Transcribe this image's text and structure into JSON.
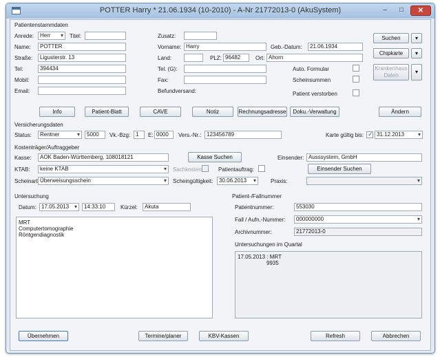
{
  "window": {
    "title": "POTTER Harry * 21.06.1934 (10-2010) - A-Nr 21772013-0 (AkuSystem)",
    "minimize": "‒",
    "maximize": "□",
    "close": "✕"
  },
  "patient": {
    "section": "Patientenstammdaten",
    "anrede_label": "Anrede:",
    "anrede": "Herr",
    "titel_label": "Titel:",
    "titel": "",
    "zusatz_label": "Zusatz:",
    "zusatz": "",
    "name_label": "Name:",
    "name": "POTTER",
    "vorname_label": "Vorname:",
    "vorname": "Harry",
    "gebdatum_label": "Geb.-Datum:",
    "gebdatum": "21.06.1934",
    "strasse_label": "Straße:",
    "strasse": "Ligusterstr. 13",
    "land_label": "Land:",
    "land": "",
    "plz_label": "PLZ:",
    "plz": "96482",
    "ort_label": "Ort:",
    "ort": "Ahorn",
    "tel_label": "Tel:",
    "tel": "394434",
    "telg_label": "Tel. (G):",
    "telg": "",
    "mobil_label": "Mobil:",
    "mobil": "",
    "fax_label": "Fax:",
    "fax": "",
    "email_label": "Email:",
    "email": "",
    "befund_label": "Befundversand:",
    "auto_formular": "Auto. Formular",
    "scheinsummen": "Scheinsummen",
    "verstorben": "Patient verstorben"
  },
  "side_buttons": {
    "suchen": "Suchen",
    "chipkarte": "Chipkarte",
    "krankenhaus": "Krankenhaus Daten"
  },
  "tabs_row": [
    "Info",
    "Patient-Blatt",
    "CAVE",
    "Notiz",
    "Rechnungsadresse",
    "Doku.-Verwaltung"
  ],
  "aendern": "Ändern",
  "insurance": {
    "section": "Versicherungsdaten",
    "status_label": "Status:",
    "status": "Rentner",
    "status_code": "5000",
    "vknr_label": "Vk.-Bzg:",
    "vknr": "1",
    "e_label": "E:",
    "e": "0000",
    "versnr_label": "Vers.-Nr.:",
    "versnr": "123456789",
    "karte_label": "Karte gültig bis:",
    "karte": "31.12.2013"
  },
  "kostentraeger": {
    "section": "Kostenträger/Auftraggeber",
    "kasse_label": "Kasse:",
    "kasse": "AOK Baden-Württemberg, 108018121",
    "kasse_suchen": "Kasse Suchen",
    "einsender_label": "Einsender:",
    "einsender": "Ausssystem, GmbH",
    "ktab_label": "KTAB:",
    "ktab": "keine KTAB",
    "sachkosten_label": "Sachkosten:",
    "patientauftrag_label": "Patientauftrag:",
    "einsender_suchen": "Einsender Suchen",
    "scheinart_label": "Scheinart:",
    "scheinart": "Überweisungsschein",
    "scheingueltig_label": "Scheingültigkeit:",
    "scheingueltig": "30.06.2013",
    "praxis_label": "Praxis:",
    "praxis": ""
  },
  "untersuchung": {
    "section": "Untersuchung",
    "datum_label": "Datum:",
    "datum": "17.05.2013",
    "zeit": "14:33:10",
    "kuerzel_label": "Kürzel:",
    "kuerzel": "Akuta",
    "lines": [
      "MRT",
      "Computertomographie",
      "Röntgendiagnostik"
    ]
  },
  "fallnummer": {
    "section": "Patient-/Fallnummer",
    "patnr_label": "Patientnummer:",
    "patnr": "553030",
    "fallnr_label": "Fall / Aufn.-Nummer:",
    "fallnr": "000000000",
    "archiv_label": "Archivnummer:",
    "archiv": "21772013-0",
    "quartal_label": "Untersuchungen im Quartal",
    "quartal_line1": "17.05.2013 : MRT",
    "quartal_line2": "9935"
  },
  "footer": [
    "Übernehmen",
    "Termine/planer",
    "KBV-Kassen",
    "Refresh",
    "Abbrechen"
  ]
}
